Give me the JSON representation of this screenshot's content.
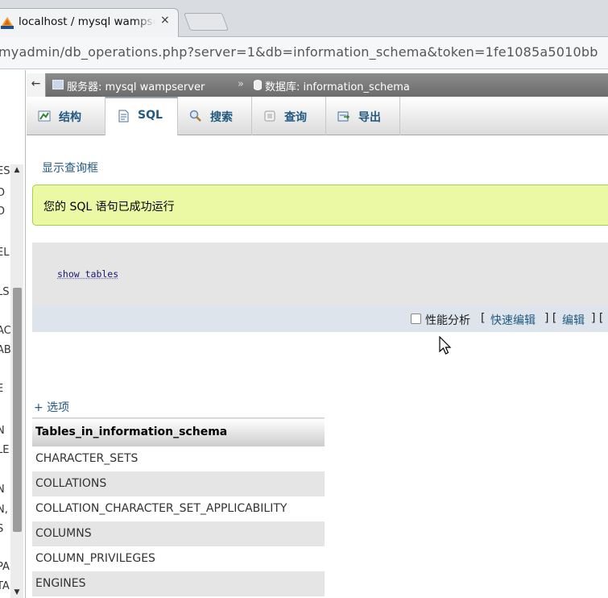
{
  "browser": {
    "tab_title": "localhost / mysql wampserver",
    "close_glyph": "×",
    "url": "myadmin/db_operations.php?server=1&db=information_schema&token=1fe1085a5010bb"
  },
  "left_nav": {
    "items": [
      "ES",
      "D",
      "D",
      "EL",
      "LS",
      "AC",
      "AB",
      "E",
      "N",
      "LE",
      "N",
      "N,",
      "S",
      "PA",
      "TA"
    ]
  },
  "breadcrumb": {
    "collapse_glyph": "←",
    "server": "服务器: mysql wampserver",
    "separator": "»",
    "database": "数据库: information_schema"
  },
  "menu": {
    "tabs": [
      {
        "label": "结构",
        "icon": "structure-icon",
        "active": false
      },
      {
        "label": "SQL",
        "icon": "sql-icon",
        "active": true
      },
      {
        "label": "搜索",
        "icon": "search-icon",
        "active": false
      },
      {
        "label": "查询",
        "icon": "query-icon",
        "active": false
      },
      {
        "label": "导出",
        "icon": "export-icon",
        "active": false
      }
    ]
  },
  "main": {
    "show_query_link": "显示查询框",
    "success_message": "您的 SQL 语句已成功运行",
    "sql_text": "show tables",
    "profiling_label": "性能分析",
    "inline_edit_link": "快速编辑",
    "edit_link": "编辑",
    "options_link": "+ 选项"
  },
  "result_table": {
    "header": "Tables_in_information_schema",
    "rows": [
      "CHARACTER_SETS",
      "COLLATIONS",
      "COLLATION_CHARACTER_SET_APPLICABILITY",
      "COLUMNS",
      "COLUMN_PRIVILEGES",
      "ENGINES"
    ]
  },
  "colors": {
    "link": "#235a81",
    "success_bg": "#ebf8a4",
    "success_border": "#a2d246",
    "breadcrumb_bg": "#6c6c6c",
    "row_alt": "#e5e5e5"
  }
}
